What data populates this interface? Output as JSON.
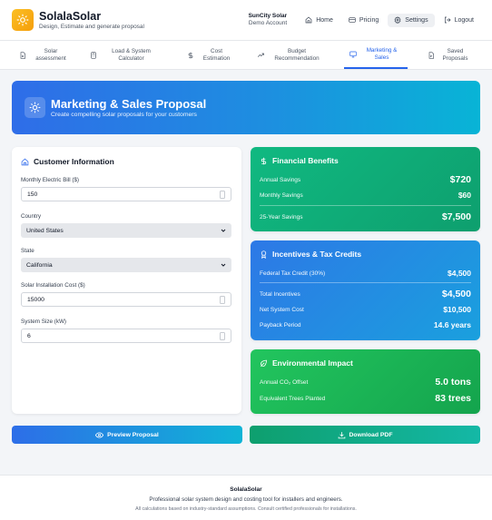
{
  "brand": {
    "title": "SolalaSolar",
    "subtitle": "Design, Estimate and generate proposal",
    "logo_icon": "sun-icon",
    "accent": "#f59e0b"
  },
  "account": {
    "name": "SunCity Solar",
    "role": "Demo Account"
  },
  "nav": [
    {
      "label": "Home",
      "icon": "home-icon"
    },
    {
      "label": "Pricing",
      "icon": "card-icon"
    },
    {
      "label": "Settings",
      "icon": "gear-icon",
      "active": true
    },
    {
      "label": "Logout",
      "icon": "logout-icon"
    }
  ],
  "tabs": [
    {
      "label": "Solar assessment",
      "icon": "document-icon"
    },
    {
      "label": "Load & System Calculator",
      "icon": "calculator-icon"
    },
    {
      "label": "Cost Estimation",
      "icon": "dollar-icon"
    },
    {
      "label": "Budget Recommendation",
      "icon": "trend-icon"
    },
    {
      "label": "Marketing & Sales",
      "icon": "monitor-icon",
      "active": true
    },
    {
      "label": "Saved Proposals",
      "icon": "file-icon"
    }
  ],
  "banner": {
    "title": "Marketing & Sales Proposal",
    "subtitle": "Create compelling solar proposals for your customers"
  },
  "customer": {
    "title": "Customer Information",
    "bill_label": "Monthly Electric Bill ($)",
    "bill_value": "150",
    "country_label": "Country",
    "country_value": "United States",
    "state_label": "State",
    "state_value": "California",
    "cost_label": "Solar Installation Cost ($)",
    "cost_value": "15000",
    "size_label": "System Size (kW)",
    "size_value": "6"
  },
  "financial": {
    "title": "Financial Benefits",
    "annual_label": "Annual Savings",
    "annual_value": "$720",
    "monthly_label": "Monthly Savings",
    "monthly_value": "$60",
    "y25_label": "25-Year Savings",
    "y25_value": "$7,500",
    "color": "#10b981"
  },
  "incentives": {
    "title": "Incentives & Tax Credits",
    "federal_label": "Federal Tax Credit (30%)",
    "federal_value": "$4,500",
    "total_label": "Total Incentives",
    "total_value": "$4,500",
    "net_label": "Net System Cost",
    "net_value": "$10,500",
    "payback_label": "Payback Period",
    "payback_value": "14.6 years",
    "color": "#2d78e6"
  },
  "environment": {
    "title": "Environmental Impact",
    "co2_label": "Annual CO₂ Offset",
    "co2_value": "5.0 tons",
    "trees_label": "Equivalent Trees Planted",
    "trees_value": "83 trees",
    "color": "#22c55e"
  },
  "actions": {
    "preview_label": "Preview Proposal",
    "pdf_label": "Download PDF"
  },
  "footer": {
    "title": "SolalaSolar",
    "subtitle": "Professional solar system design and costing tool for installers and engineers.",
    "note": "All calculations based on industry-standard assumptions. Consult certified professionals for installations."
  }
}
